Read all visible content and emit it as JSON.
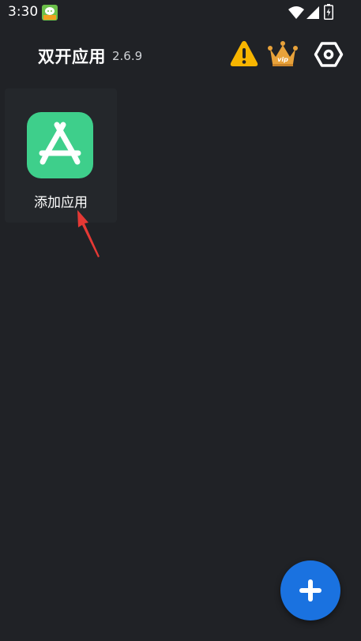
{
  "status_bar": {
    "time": "3:30",
    "icons": [
      "notification-app-icon",
      "wifi-icon",
      "cellular-icon",
      "battery-icon"
    ]
  },
  "header": {
    "title": "双开应用",
    "version": "2.6.9",
    "actions": [
      "warning-icon",
      "vip-crown-icon",
      "settings-hexagon-icon"
    ],
    "vip_badge_text": "vip"
  },
  "apps": [
    {
      "label": "添加应用",
      "icon": "app-store-icon"
    }
  ],
  "fab": {
    "icon": "plus-icon"
  },
  "colors": {
    "background": "#202226",
    "tile_background": "#24272b",
    "app_icon_green": "#3ecf8b",
    "fab_blue": "#1a72e0",
    "warning_yellow": "#f7b500",
    "vip_gold": "#e8a23a",
    "arrow_red": "#e53935"
  }
}
